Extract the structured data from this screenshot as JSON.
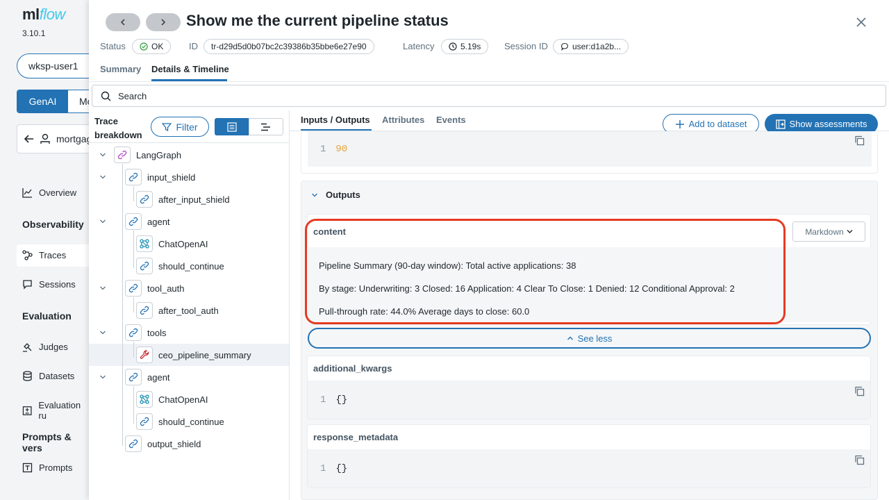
{
  "sidebar": {
    "logo_main": "ml",
    "logo_italic": "flow",
    "version": "3.10.1",
    "workspace": "wksp-user1",
    "mode_active": "GenAI",
    "mode_other": "Mo",
    "experiment": "mortgag",
    "nav_overview": "Overview",
    "heading_observability": "Observability",
    "nav_traces": "Traces",
    "nav_sessions": "Sessions",
    "heading_evaluation": "Evaluation",
    "nav_judges": "Judges",
    "nav_datasets": "Datasets",
    "nav_evaluation_runs": "Evaluation ru",
    "heading_prompts": "Prompts & vers",
    "nav_prompts": "Prompts"
  },
  "header": {
    "title": "Show me the current pipeline status",
    "status_label": "Status",
    "status_value": "OK",
    "id_label": "ID",
    "id_value": "tr-d29d5d0b07bc2c39386b35bbe6e27e90",
    "latency_label": "Latency",
    "latency_value": "5.19s",
    "session_label": "Session ID",
    "session_value": "user:d1a2b..."
  },
  "tabs": [
    "Summary",
    "Details & Timeline"
  ],
  "search_placeholder": "Search",
  "trace": {
    "title_line1": "Trace",
    "title_line2": "breakdown",
    "filter_label": "Filter",
    "nodes": [
      {
        "label": "LangGraph",
        "icon": "chain-icon"
      },
      {
        "label": "input_shield",
        "icon": "link-icon"
      },
      {
        "label": "after_input_shield",
        "icon": "link-icon"
      },
      {
        "label": "agent",
        "icon": "link-icon"
      },
      {
        "label": "ChatOpenAI",
        "icon": "model-icon"
      },
      {
        "label": "should_continue",
        "icon": "link-icon"
      },
      {
        "label": "tool_auth",
        "icon": "link-icon"
      },
      {
        "label": "after_tool_auth",
        "icon": "link-icon"
      },
      {
        "label": "tools",
        "icon": "link-icon"
      },
      {
        "label": "ceo_pipeline_summary",
        "icon": "wrench-icon"
      },
      {
        "label": "agent",
        "icon": "link-icon"
      },
      {
        "label": "ChatOpenAI",
        "icon": "model-icon"
      },
      {
        "label": "should_continue",
        "icon": "link-icon"
      },
      {
        "label": "output_shield",
        "icon": "link-icon"
      }
    ]
  },
  "detail": {
    "tabs": [
      "Inputs / Outputs",
      "Attributes",
      "Events"
    ],
    "add_dataset": "Add to dataset",
    "show_assessments": "Show assessments",
    "input_line_no": "1",
    "input_value": "90",
    "outputs_label": "Outputs",
    "content_label": "content",
    "markdown_label": "Markdown",
    "content_lines": [
      "Pipeline Summary (90-day window): Total active applications: 38",
      "By stage: Underwriting: 3 Closed: 16 Application: 4 Clear To Close: 1 Denied: 12 Conditional Approval: 2",
      "Pull-through rate: 44.0% Average days to close: 60.0"
    ],
    "see_less": "See less",
    "kwargs_label": "additional_kwargs",
    "kwargs_line_no": "1",
    "kwargs_value": "{}",
    "meta_label": "response_metadata",
    "meta_line_no": "1",
    "meta_value": "{}"
  },
  "colors": {
    "accent": "#2272b4",
    "highlight": "#e63a22",
    "status_ok": "#2d9f3f"
  }
}
